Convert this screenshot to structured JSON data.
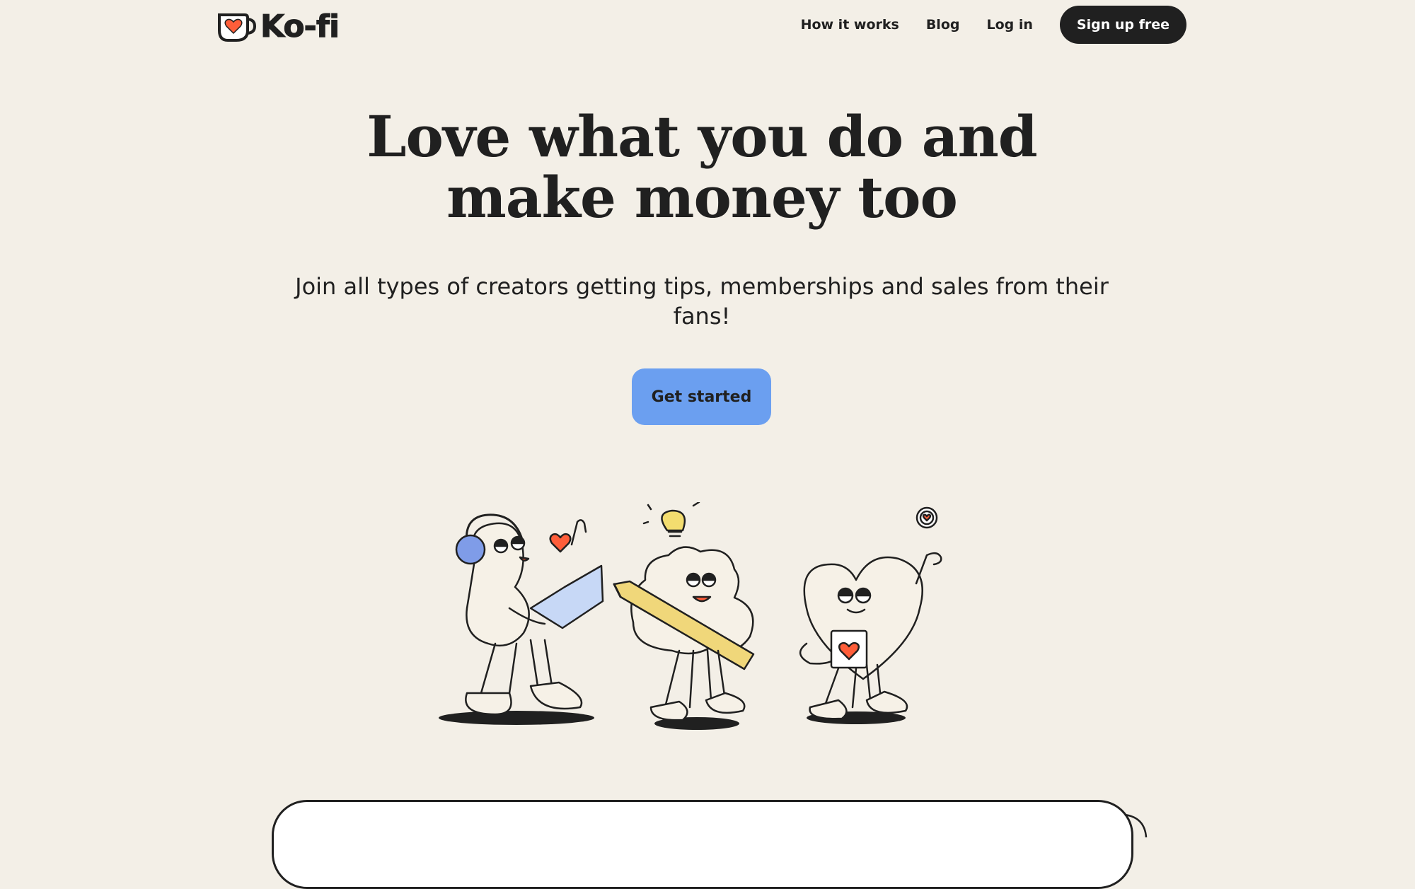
{
  "brand": {
    "name": "Ko-fi"
  },
  "nav": {
    "how_it_works": "How it works",
    "blog": "Blog",
    "log_in": "Log in",
    "sign_up": "Sign up free"
  },
  "hero": {
    "title_line1": "Love what you do and",
    "title_line2": "make money too",
    "subtitle": "Join all types of creators getting tips, memberships and sales from their fans!",
    "cta": "Get started"
  },
  "colors": {
    "background": "#f3efe7",
    "ink": "#202020",
    "cta": "#6b9ff0",
    "heart": "#ff5e3a",
    "pencil": "#f0d77a",
    "headphones": "#7f9ce8"
  },
  "icons": [
    "kofi-cup-logo-icon",
    "headphones-icon",
    "laptop-icon",
    "heart-icon",
    "lightbulb-icon",
    "pencil-icon",
    "mug-icon"
  ]
}
